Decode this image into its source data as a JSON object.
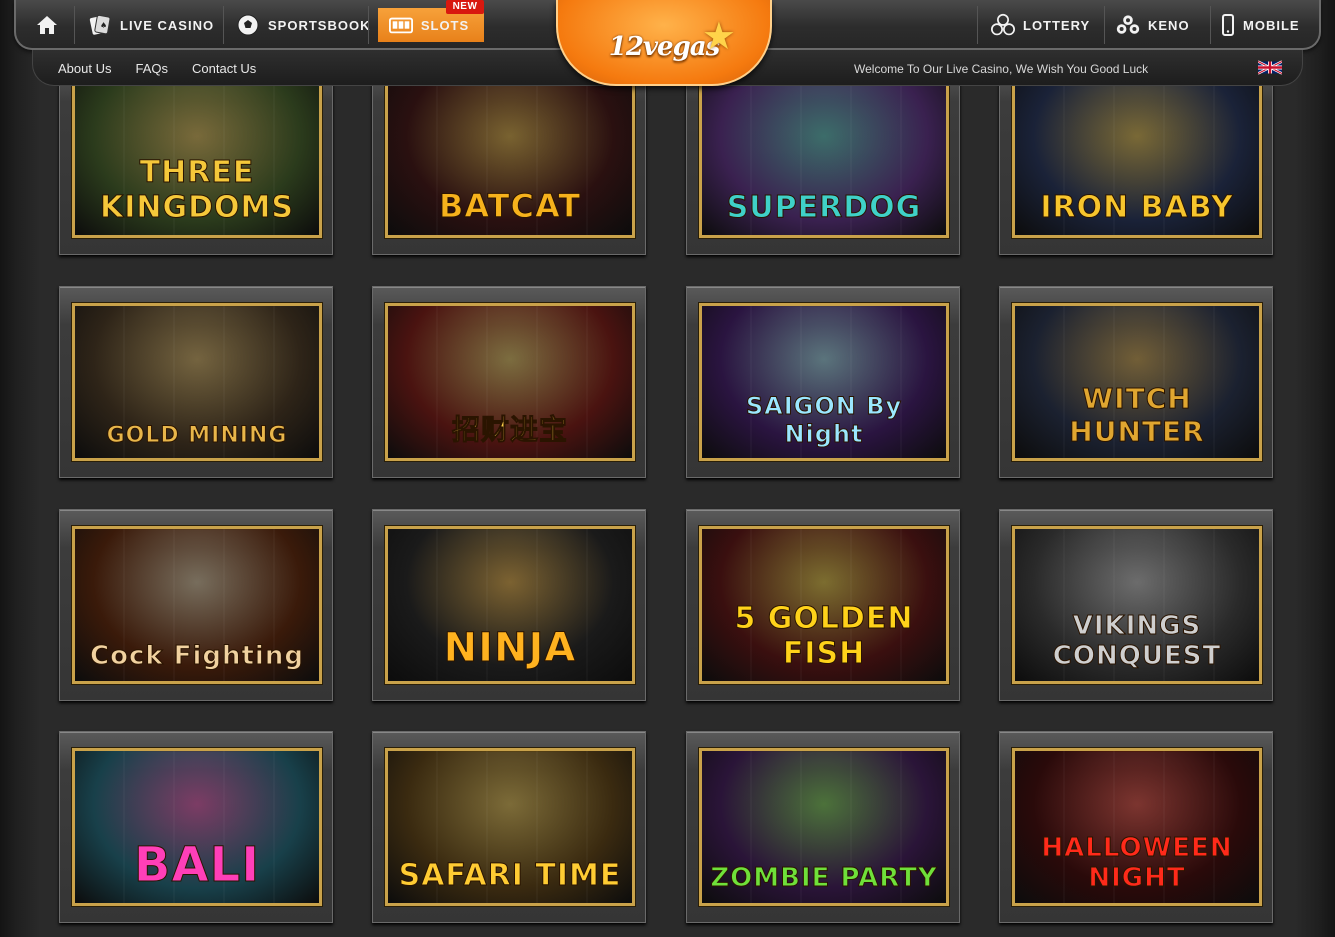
{
  "nav": {
    "home_label": "",
    "live_casino": "LIVE CASINO",
    "sportsbook": "SPORTSBOOK",
    "slots": "SLOTS",
    "new_badge": "NEW",
    "lottery": "LOTTERY",
    "keno": "KENO",
    "mobile": "MOBILE"
  },
  "logo": {
    "text": "12vegas"
  },
  "subnav": {
    "about": "About Us",
    "faqs": "FAQs",
    "contact": "Contact Us",
    "welcome": "Welcome To Our Live Casino, We Wish You Good Luck"
  },
  "colors": {
    "accent_orange": "#f28c1e",
    "frame_gold": "#c9a24a",
    "new_red": "#d8180f"
  },
  "games": [
    {
      "title": "THREE KINGDOMS",
      "bg": "#2b3b1c",
      "color": "#f5c83a"
    },
    {
      "title": "BATCAT",
      "bg": "#2a1010",
      "color": "#f6b21c"
    },
    {
      "title": "SUPERDOG",
      "bg": "#3a2150",
      "color": "#3fd1c8"
    },
    {
      "title": "IRON BABY",
      "bg": "#1a2238",
      "color": "#f7c52d"
    },
    {
      "title": "GOLD MINING",
      "bg": "#2e2418",
      "color": "#e8b64a"
    },
    {
      "title": "招财进宝",
      "bg": "#4a1310",
      "color": "#ffd24a"
    },
    {
      "title": "SAIGON By Night",
      "bg": "#2a1440",
      "color": "#9be7ff"
    },
    {
      "title": "WITCH HUNTER",
      "bg": "#1b2130",
      "color": "#e0a630"
    },
    {
      "title": "Cock Fighting",
      "bg": "#3a1a0a",
      "color": "#f1d2a0"
    },
    {
      "title": "NINJA",
      "bg": "#1a1a1a",
      "color": "#ffb21f"
    },
    {
      "title": "5 GOLDEN FISH",
      "bg": "#3a0f0f",
      "color": "#ffd21a"
    },
    {
      "title": "VIKINGS CONQUEST",
      "bg": "#2a2a2a",
      "color": "#cfcfcf"
    },
    {
      "title": "BALI",
      "bg": "#18404a",
      "color": "#ff3fb8"
    },
    {
      "title": "SAFARI TIME",
      "bg": "#3a2a10",
      "color": "#ffcc33"
    },
    {
      "title": "ZOMBIE PARTY",
      "bg": "#2a1438",
      "color": "#6fe03a"
    },
    {
      "title": "HALLOWEEN NIGHT",
      "bg": "#2a0a0a",
      "color": "#ff2a1a"
    }
  ]
}
